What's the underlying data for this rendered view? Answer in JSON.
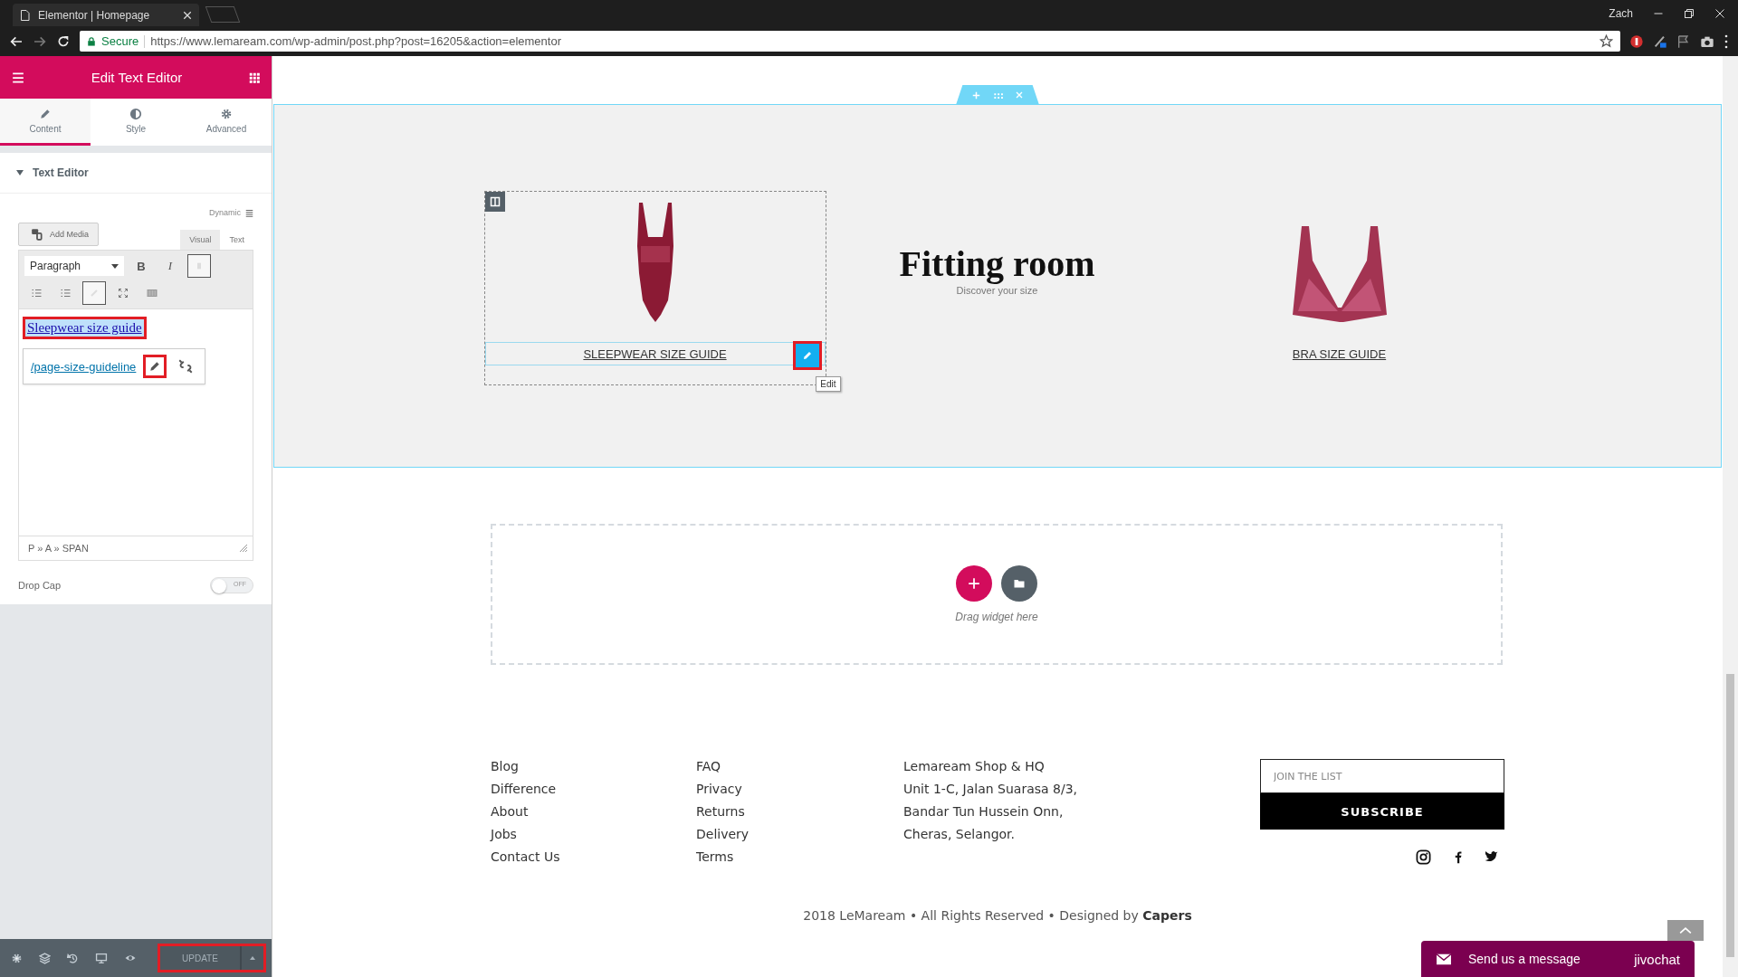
{
  "browser": {
    "tab_title": "Elementor | Homepage",
    "user": "Zach",
    "secure_label": "Secure",
    "url": "https://www.lemaream.com/wp-admin/post.php?post=16205&action=elementor"
  },
  "panel": {
    "title": "Edit Text Editor",
    "tabs": [
      {
        "kind": "pencil",
        "label": "Content",
        "selected": true
      },
      {
        "kind": "contrast",
        "label": "Style",
        "selected": false
      },
      {
        "kind": "gear",
        "label": "Advanced",
        "selected": false
      }
    ],
    "section": {
      "title": "Text Editor",
      "expanded": true
    },
    "dynamic_label": "Dynamic",
    "add_media": "Add Media",
    "editor_tabs": [
      {
        "label": "Visual",
        "selected": true
      },
      {
        "label": "Text",
        "selected": false
      }
    ],
    "format_select": "Paragraph",
    "bold_key": "B",
    "italic_key": "I",
    "link_text": {
      "text": "Sleepwear size guide",
      "highlighted": true
    },
    "link_popup": {
      "url": "/page-size-guideline",
      "edit_highlighted": true
    },
    "element_path": "P » A » SPAN",
    "drop_cap": {
      "label": "Drop Cap",
      "on": false,
      "off_label": "OFF"
    },
    "update": {
      "label": "UPDATE",
      "highlighted": true
    }
  },
  "canvas": {
    "products": [
      {
        "kind": "bodysuit",
        "label": "SLEEPWEAR SIZE GUIDE",
        "selected": true
      },
      {
        "kind": "bra",
        "label": "BRA SIZE GUIDE",
        "selected": false
      }
    ],
    "heading": "Fitting room",
    "subheading": "Discover your size",
    "edit_tooltip": "Edit",
    "edit_highlighted": true,
    "drop_zone": {
      "label": "Drag widget here"
    }
  },
  "footer": {
    "column_1": [
      "Blog",
      "Difference",
      "About",
      "Jobs",
      "Contact Us"
    ],
    "column_2": [
      "FAQ",
      "Privacy",
      "Returns",
      "Delivery",
      "Terms"
    ],
    "address": [
      "Lemaream Shop & HQ",
      "Unit 1-C, Jalan Suarasa 8/3,",
      "Bandar Tun Hussein Onn,",
      "Cheras, Selangor."
    ],
    "newsletter_placeholder": "JOIN THE LIST",
    "subscribe": "SUBSCRIBE",
    "copyright": "2018 LeMaream • All Rights Reserved • Designed by **Capers**"
  },
  "chat": {
    "label": "Send us a message",
    "brand": "jivochat"
  }
}
